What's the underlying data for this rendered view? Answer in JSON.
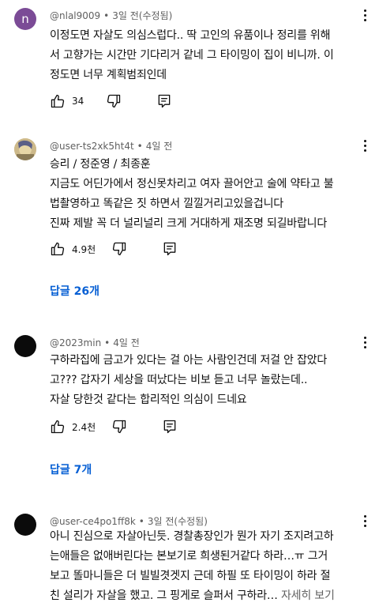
{
  "comments": [
    {
      "avatar_letter": "n",
      "author": "@nlal9009",
      "time": "3일 전(수정됨)",
      "lines": [
        "이정도면 자살도 의심스럽다..  딱 고인의 유품이나 정리를 위해",
        "서 고향가는 시간만 기다리거 같네  그 타이밍이 집이 비니까. 이",
        "정도면 너무 계획범죄인데"
      ],
      "likes": "34"
    },
    {
      "author": "@user-ts2xk5ht4t",
      "time": "4일 전",
      "lines": [
        "승리 / 정준영 / 최종훈",
        "지금도 어딘가에서 정신못차리고 여자 끌어안고 술에 약타고 불",
        "법촬영하고 똑같은 짓 하면서 낄낄거리고있을겁니다",
        "진짜 제발 꼭 더 널리널리 크게 거대하게 재조명 되길바랍니다"
      ],
      "likes": "4.9천",
      "replies": "답글 26개"
    },
    {
      "author": "@2023min",
      "time": "4일 전",
      "lines": [
        "구하라집에 금고가 있다는 걸 아는 사람인건데 저걸 안 잡았다",
        "고??? 갑자기 세상을 떠났다는 비보 듣고 너무 놀랐는데..",
        "자살 당한것 같다는 합리적인 의심이 드네요"
      ],
      "likes": "2.4천",
      "replies": "답글 7개"
    },
    {
      "author": "@user-ce4po1ff8k",
      "time": "3일 전(수정됨)",
      "lines": [
        "아니 진심으로 자살아닌듯.  경찰총장인가 뭔가 자기 조지려고하",
        "는애들은 없애버린다는 본보기로 희생된거같다 하라…ㅠ 그거",
        "보고 똘마니들은 더 빌빌겻겟지 근데 하필 또 타이밍이 하라 절",
        "친 설리가 자살을 했고. 그 핑게로 슬퍼서 구하라…"
      ],
      "more": "자세히 보기"
    }
  ],
  "separator": "•",
  "colors": {
    "reply_link": "#065fd4",
    "meta": "#606060"
  }
}
